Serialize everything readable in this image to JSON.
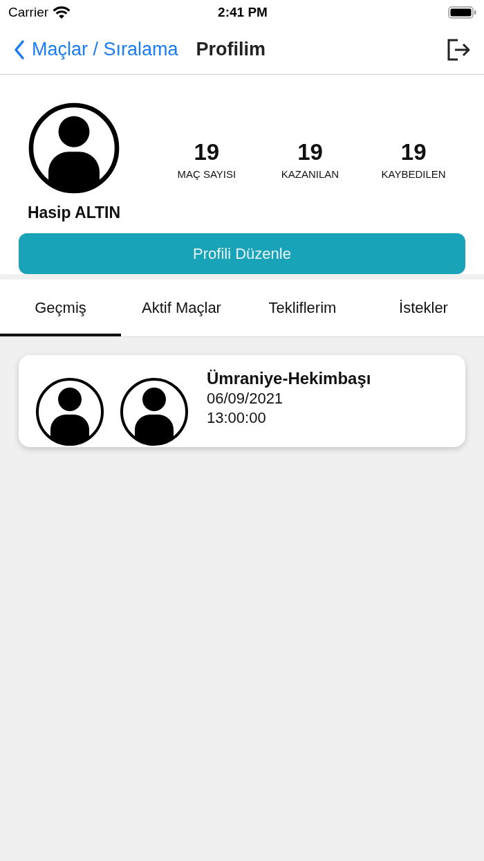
{
  "status_bar": {
    "carrier": "Carrier",
    "time": "2:41 PM"
  },
  "nav": {
    "back_label": "Maçlar / Sıralama",
    "title": "Profilim"
  },
  "profile": {
    "name": "Hasip ALTIN",
    "stats": [
      {
        "value": "19",
        "label": "MAÇ SAYISI"
      },
      {
        "value": "19",
        "label": "KAZANILAN"
      },
      {
        "value": "19",
        "label": "KAYBEDILEN"
      }
    ],
    "edit_button": "Profili Düzenle"
  },
  "tabs": [
    {
      "label": "Geçmiş",
      "selected": true
    },
    {
      "label": "Aktif Maçlar",
      "selected": false
    },
    {
      "label": "Tekliflerim",
      "selected": false
    },
    {
      "label": "İstekler",
      "selected": false
    }
  ],
  "matches": [
    {
      "location": "Ümraniye-Hekimbaşı",
      "date": "06/09/2021",
      "time": "13:00:00"
    }
  ]
}
